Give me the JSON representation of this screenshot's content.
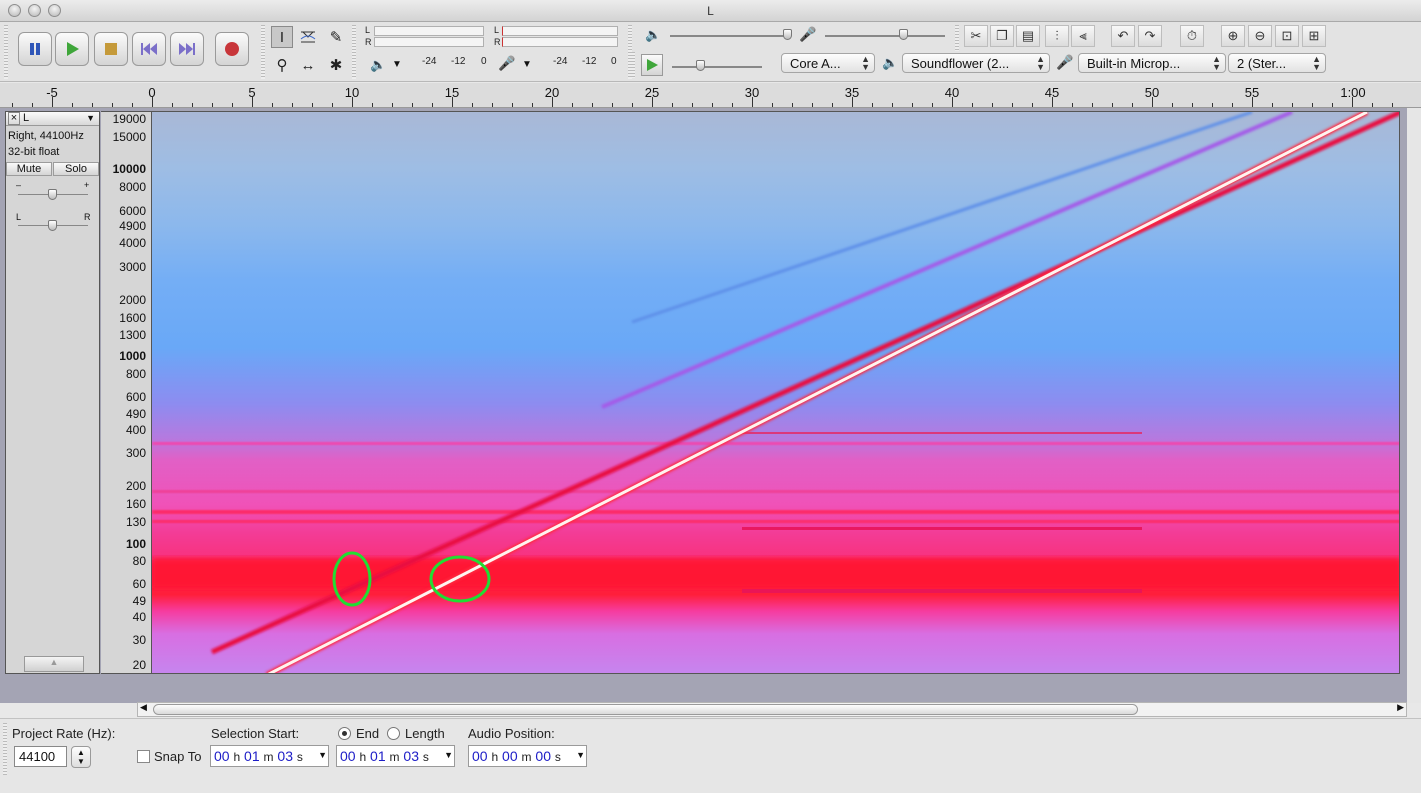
{
  "window": {
    "title": "L"
  },
  "transport": {
    "pause_icon": "pause-icon",
    "play_icon": "play-icon",
    "stop_icon": "stop-icon",
    "skip_start_icon": "skip-to-start-icon",
    "skip_end_icon": "skip-to-end-icon",
    "record_icon": "record-icon"
  },
  "meters": {
    "play_lr": [
      "L",
      "R"
    ],
    "record_lr": [
      "L",
      "R"
    ],
    "play_ticks": [
      "-24",
      "-12",
      "0"
    ],
    "record_ticks": [
      "-24",
      "-12",
      "0"
    ]
  },
  "device_toolbar": {
    "host": "Core A...",
    "output": "Soundflower (2...",
    "input": "Built-in Microp...",
    "channels": "2 (Ster..."
  },
  "ruler": {
    "labels": [
      "-5",
      "0",
      "5",
      "10",
      "15",
      "20",
      "25",
      "30",
      "35",
      "40",
      "45",
      "50",
      "55",
      "1:00"
    ]
  },
  "track": {
    "close": "×",
    "name": "L",
    "info_line1": "Right, 44100Hz",
    "info_line2": "32-bit float",
    "mute_label": "Mute",
    "solo_label": "Solo",
    "gain_minus": "–",
    "gain_plus": "+",
    "pan_left": "L",
    "pan_right": "R"
  },
  "freq_scale": {
    "labels": [
      {
        "t": "19000",
        "b": false
      },
      {
        "t": "15000",
        "b": false
      },
      {
        "t": "10000",
        "b": true
      },
      {
        "t": "8000",
        "b": false
      },
      {
        "t": "6000",
        "b": false
      },
      {
        "t": "4900",
        "b": false
      },
      {
        "t": "4000",
        "b": false
      },
      {
        "t": "3000",
        "b": false
      },
      {
        "t": "2000",
        "b": false
      },
      {
        "t": "1600",
        "b": false
      },
      {
        "t": "1300",
        "b": false
      },
      {
        "t": "1000",
        "b": true
      },
      {
        "t": "800",
        "b": false
      },
      {
        "t": "600",
        "b": false
      },
      {
        "t": "490",
        "b": false
      },
      {
        "t": "400",
        "b": false
      },
      {
        "t": "300",
        "b": false
      },
      {
        "t": "200",
        "b": false
      },
      {
        "t": "160",
        "b": false
      },
      {
        "t": "130",
        "b": false
      },
      {
        "t": "100",
        "b": true
      },
      {
        "t": "80",
        "b": false
      },
      {
        "t": "60",
        "b": false
      },
      {
        "t": "49",
        "b": false
      },
      {
        "t": "40",
        "b": false
      },
      {
        "t": "30",
        "b": false
      },
      {
        "t": "20",
        "b": false
      }
    ]
  },
  "selection_bar": {
    "project_rate_label": "Project Rate (Hz):",
    "project_rate_value": "44100",
    "snap_to_label": "Snap To",
    "selection_start_label": "Selection Start:",
    "end_label": "End",
    "length_label": "Length",
    "audio_position_label": "Audio Position:",
    "selection_start": {
      "h": "00",
      "m": "01",
      "s": "03"
    },
    "selection_end": {
      "h": "00",
      "m": "01",
      "s": "03"
    },
    "audio_position": {
      "h": "00",
      "m": "00",
      "s": "00"
    },
    "unit_h": "h",
    "unit_m": "m",
    "unit_s": "s"
  },
  "colors": {
    "annotation_circle": "#22dd33",
    "spectrogram_high": "#ff1e3a",
    "spectrogram_low": "#69a8f7"
  }
}
